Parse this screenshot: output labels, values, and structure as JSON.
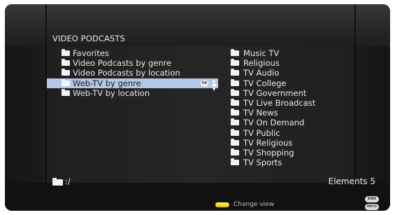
{
  "header": {
    "title": "VIDEO PODCASTS"
  },
  "left_list": {
    "items": [
      {
        "label": "Favorites",
        "selected": false
      },
      {
        "label": "Video Podcasts by genre",
        "selected": false
      },
      {
        "label": "Video Podcasts by location",
        "selected": false
      },
      {
        "label": "Web-TV by genre",
        "selected": true
      },
      {
        "label": "Web-TV by location",
        "selected": false
      }
    ],
    "ok_label": "OK"
  },
  "right_list": {
    "items": [
      {
        "label": "Music TV"
      },
      {
        "label": "Religious"
      },
      {
        "label": "TV Audio"
      },
      {
        "label": "TV College"
      },
      {
        "label": "TV Government"
      },
      {
        "label": "TV Live Broadcast"
      },
      {
        "label": "TV News"
      },
      {
        "label": "TV On Demand"
      },
      {
        "label": "TV Public"
      },
      {
        "label": "TV Religious"
      },
      {
        "label": "TV Shopping"
      },
      {
        "label": "TV Sports"
      }
    ]
  },
  "status": {
    "path": ":/",
    "elements": "Elements 5"
  },
  "footer": {
    "change_view_label": "Change view",
    "end_label": "END",
    "info_label": "INFO"
  },
  "icons": {
    "folder": "folder-icon",
    "ok": "ok-button-icon",
    "nav": "nav-arrows-icon",
    "yellow_key": "yellow-key-icon"
  },
  "colors": {
    "background": "#111111",
    "selection": "#b3c8e6",
    "text": "#e9e9e9",
    "yellow_key": "#f3d400"
  }
}
